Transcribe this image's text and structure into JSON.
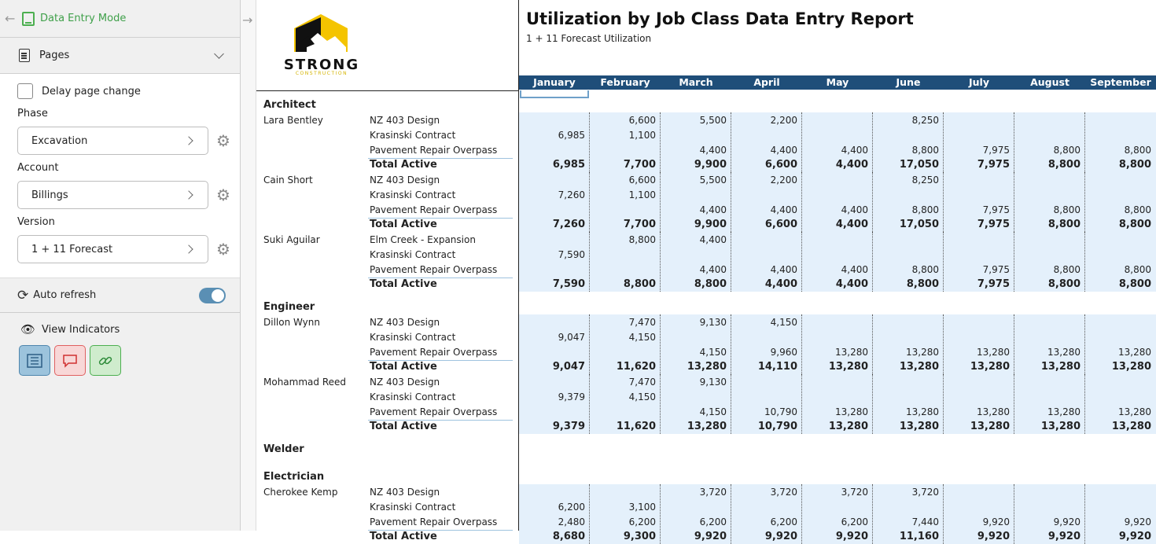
{
  "sidebar": {
    "mode_label": "Data Entry Mode",
    "pages_label": "Pages",
    "delay_label": "Delay page change",
    "phase": {
      "label": "Phase",
      "value": "Excavation"
    },
    "account": {
      "label": "Account",
      "value": "Billings"
    },
    "version": {
      "label": "Version",
      "value": "1 + 11 Forecast"
    },
    "auto_refresh_label": "Auto refresh",
    "view_indicators_label": "View Indicators"
  },
  "logo": {
    "name": "STRONG",
    "sub": "CONSTRUCTION"
  },
  "report": {
    "title": "Utilization by Job Class Data Entry Report",
    "subtitle": "1 + 11 Forecast Utilization",
    "months": [
      "January",
      "February",
      "March",
      "April",
      "May",
      "June",
      "July",
      "August",
      "September"
    ],
    "sections": [
      {
        "category": "Architect",
        "employees": [
          {
            "name": "Lara Bentley",
            "rows": [
              {
                "job": "NZ 403 Design",
                "values": [
                  "",
                  "6,600",
                  "5,500",
                  "2,200",
                  "",
                  "8,250",
                  "",
                  "",
                  ""
                ]
              },
              {
                "job": "Krasinski Contract",
                "values": [
                  "6,985",
                  "1,100",
                  "",
                  "",
                  "",
                  "",
                  "",
                  "",
                  ""
                ]
              },
              {
                "job": "Pavement Repair Overpass",
                "values": [
                  "",
                  "",
                  "4,400",
                  "4,400",
                  "4,400",
                  "8,800",
                  "7,975",
                  "8,800",
                  "8,800"
                ]
              },
              {
                "job": "Total Active",
                "total": true,
                "values": [
                  "6,985",
                  "7,700",
                  "9,900",
                  "6,600",
                  "4,400",
                  "17,050",
                  "7,975",
                  "8,800",
                  "8,800"
                ]
              }
            ]
          },
          {
            "name": "Cain Short",
            "rows": [
              {
                "job": "NZ 403 Design",
                "values": [
                  "",
                  "6,600",
                  "5,500",
                  "2,200",
                  "",
                  "8,250",
                  "",
                  "",
                  ""
                ]
              },
              {
                "job": "Krasinski Contract",
                "values": [
                  "7,260",
                  "1,100",
                  "",
                  "",
                  "",
                  "",
                  "",
                  "",
                  ""
                ]
              },
              {
                "job": "Pavement Repair Overpass",
                "values": [
                  "",
                  "",
                  "4,400",
                  "4,400",
                  "4,400",
                  "8,800",
                  "7,975",
                  "8,800",
                  "8,800"
                ]
              },
              {
                "job": "Total Active",
                "total": true,
                "values": [
                  "7,260",
                  "7,700",
                  "9,900",
                  "6,600",
                  "4,400",
                  "17,050",
                  "7,975",
                  "8,800",
                  "8,800"
                ]
              }
            ]
          },
          {
            "name": "Suki Aguilar",
            "rows": [
              {
                "job": "Elm Creek - Expansion",
                "values": [
                  "",
                  "8,800",
                  "4,400",
                  "",
                  "",
                  "",
                  "",
                  "",
                  ""
                ]
              },
              {
                "job": "Krasinski Contract",
                "values": [
                  "7,590",
                  "",
                  "",
                  "",
                  "",
                  "",
                  "",
                  "",
                  ""
                ]
              },
              {
                "job": "Pavement Repair Overpass",
                "values": [
                  "",
                  "",
                  "4,400",
                  "4,400",
                  "4,400",
                  "8,800",
                  "7,975",
                  "8,800",
                  "8,800"
                ]
              },
              {
                "job": "Total Active",
                "total": true,
                "values": [
                  "7,590",
                  "8,800",
                  "8,800",
                  "4,400",
                  "4,400",
                  "8,800",
                  "7,975",
                  "8,800",
                  "8,800"
                ]
              }
            ]
          }
        ]
      },
      {
        "category": "Engineer",
        "employees": [
          {
            "name": "Dillon Wynn",
            "rows": [
              {
                "job": "NZ 403 Design",
                "values": [
                  "",
                  "7,470",
                  "9,130",
                  "4,150",
                  "",
                  "",
                  "",
                  "",
                  ""
                ]
              },
              {
                "job": "Krasinski Contract",
                "values": [
                  "9,047",
                  "4,150",
                  "",
                  "",
                  "",
                  "",
                  "",
                  "",
                  ""
                ]
              },
              {
                "job": "Pavement Repair Overpass",
                "values": [
                  "",
                  "",
                  "4,150",
                  "9,960",
                  "13,280",
                  "13,280",
                  "13,280",
                  "13,280",
                  "13,280"
                ]
              },
              {
                "job": "Total Active",
                "total": true,
                "values": [
                  "9,047",
                  "11,620",
                  "13,280",
                  "14,110",
                  "13,280",
                  "13,280",
                  "13,280",
                  "13,280",
                  "13,280"
                ]
              }
            ]
          },
          {
            "name": "Mohammad Reed",
            "rows": [
              {
                "job": "NZ 403 Design",
                "values": [
                  "",
                  "7,470",
                  "9,130",
                  "",
                  "",
                  "",
                  "",
                  "",
                  ""
                ]
              },
              {
                "job": "Krasinski Contract",
                "values": [
                  "9,379",
                  "4,150",
                  "",
                  "",
                  "",
                  "",
                  "",
                  "",
                  ""
                ]
              },
              {
                "job": "Pavement Repair Overpass",
                "values": [
                  "",
                  "",
                  "4,150",
                  "10,790",
                  "13,280",
                  "13,280",
                  "13,280",
                  "13,280",
                  "13,280"
                ]
              },
              {
                "job": "Total Active",
                "total": true,
                "values": [
                  "9,379",
                  "11,620",
                  "13,280",
                  "10,790",
                  "13,280",
                  "13,280",
                  "13,280",
                  "13,280",
                  "13,280"
                ]
              }
            ]
          }
        ]
      },
      {
        "category": "Welder",
        "employees": []
      },
      {
        "category": "Electrician",
        "employees": [
          {
            "name": "Cherokee Kemp",
            "rows": [
              {
                "job": "NZ 403 Design",
                "values": [
                  "",
                  "",
                  "3,720",
                  "3,720",
                  "3,720",
                  "3,720",
                  "",
                  "",
                  ""
                ]
              },
              {
                "job": "Krasinski Contract",
                "values": [
                  "6,200",
                  "3,100",
                  "",
                  "",
                  "",
                  "",
                  "",
                  "",
                  ""
                ]
              },
              {
                "job": "Pavement Repair Overpass",
                "values": [
                  "2,480",
                  "6,200",
                  "6,200",
                  "6,200",
                  "6,200",
                  "7,440",
                  "9,920",
                  "9,920",
                  "9,920"
                ]
              },
              {
                "job": "Total Active",
                "total": true,
                "values": [
                  "8,680",
                  "9,300",
                  "9,920",
                  "9,920",
                  "9,920",
                  "11,160",
                  "9,920",
                  "9,920",
                  "9,920"
                ]
              }
            ]
          }
        ]
      }
    ]
  }
}
